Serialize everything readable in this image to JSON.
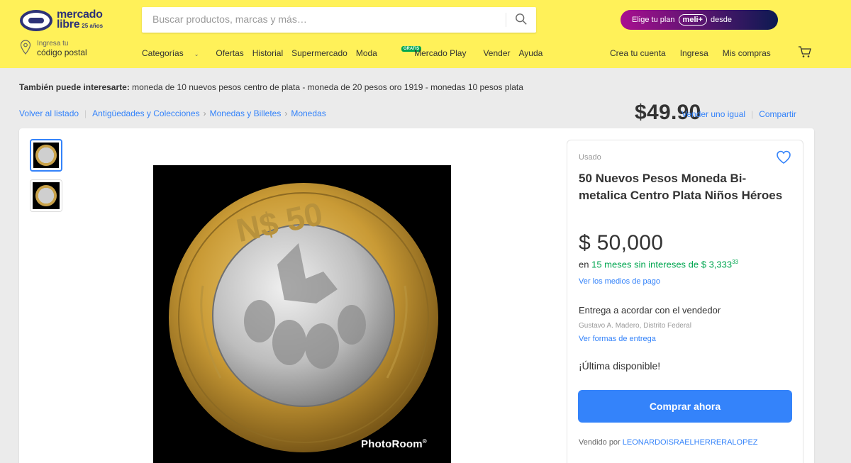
{
  "header": {
    "logo_line1": "mercado",
    "logo_line2": "libre",
    "logo_years": "25 años",
    "search_placeholder": "Buscar productos, marcas y más…",
    "promo_prefix": "Elige tu plan",
    "promo_badge": "meli+",
    "promo_mid": "desde",
    "promo_price": "$49.90",
    "location_line1": "Ingresa tu",
    "location_line2": "código postal",
    "nav": {
      "categorias": "Categorías",
      "ofertas": "Ofertas",
      "historial": "Historial",
      "supermercado": "Supermercado",
      "moda": "Moda",
      "mercado_play": "Mercado Play",
      "gratis_badge": "GRATIS",
      "vender": "Vender",
      "ayuda": "Ayuda"
    },
    "account": {
      "crea": "Crea tu cuenta",
      "ingresa": "Ingresa",
      "compras": "Mis compras"
    }
  },
  "related": {
    "label": "También puede interesarte:",
    "items": "moneda de 10 nuevos pesos centro de plata - moneda de 20 pesos oro 1919 - monedas 10 pesos plata"
  },
  "breadcrumb": {
    "back": "Volver al listado",
    "c1": "Antigüedades y Colecciones",
    "c2": "Monedas y Billetes",
    "c3": "Monedas",
    "sell_same": "Vender uno igual",
    "share": "Compartir"
  },
  "gallery": {
    "watermark": "PhotoRoom",
    "watermark_mark": "®"
  },
  "product": {
    "condition": "Usado",
    "title": "50 Nuevos Pesos Moneda Bi-metalica Centro Plata Niños Héroes",
    "price": "$ 50,000",
    "installments_prefix": "en",
    "installments_green": "15 meses sin intereses de $ 3,333",
    "installments_cents": "33",
    "payment_link": "Ver los medios de pago",
    "delivery": "Entrega a acordar con el vendedor",
    "location": "Gustavo A. Madero, Distrito Federal",
    "delivery_link": "Ver formas de entrega",
    "stock": "¡Última disponible!",
    "buy_button": "Comprar ahora",
    "seller_prefix": "Vendido por",
    "seller_name": "LEONARDOISRAELHERRERALOPEZ"
  },
  "colors": {
    "header_yellow": "#fff159",
    "link_blue": "#3483fa",
    "installment_green": "#00a650"
  }
}
